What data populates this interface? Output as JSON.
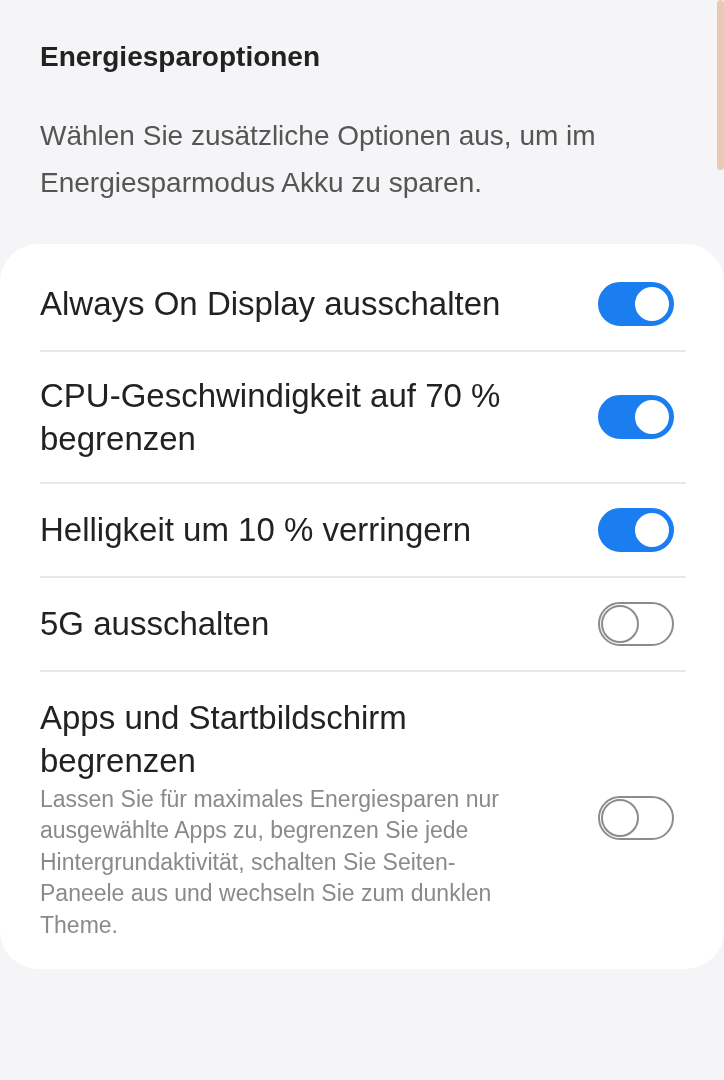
{
  "section": {
    "title": "Energiesparoptionen",
    "description": "Wählen Sie zusätzliche Optionen aus, um im Energiesparmodus Akku zu sparen."
  },
  "options": [
    {
      "label": "Always On Display ausschalten",
      "on": true
    },
    {
      "label": "CPU-Geschwindigkeit auf 70 % begrenzen",
      "on": true
    },
    {
      "label": "Helligkeit um 10 % verringern",
      "on": true
    },
    {
      "label": "5G ausschalten",
      "on": false
    },
    {
      "label": "Apps und Startbildschirm begrenzen",
      "on": false,
      "description": "Lassen Sie für maximales Energiesparen nur ausgewählte Apps zu, begrenzen Sie jede Hintergrundaktivität, schalten Sie Seiten-Paneele aus und wechseln Sie zum dunklen Theme."
    }
  ]
}
